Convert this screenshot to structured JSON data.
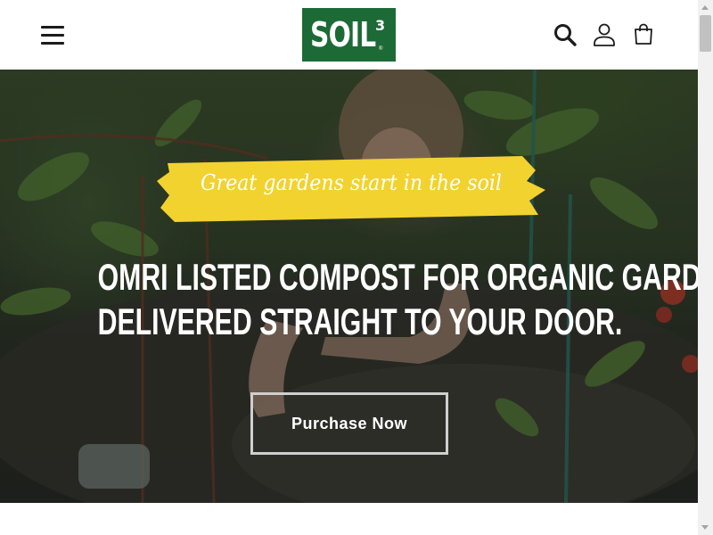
{
  "header": {
    "logo": {
      "text": "SOIL",
      "superscript": "3",
      "registered": "®",
      "color": "#1c6a35"
    },
    "icons": {
      "menu": "hamburger-menu-icon",
      "search": "search-icon",
      "account": "user-account-icon",
      "cart": "shopping-bag-icon"
    }
  },
  "hero": {
    "tagline": "Great gardens start in the soil",
    "tagline_color": "#f2d22e",
    "headline_line1": "OMRI LISTED COMPOST FOR ORGANIC GARDENING.",
    "headline_line2": "DELIVERED STRAIGHT TO YOUR DOOR.",
    "cta_label": "Purchase Now"
  }
}
